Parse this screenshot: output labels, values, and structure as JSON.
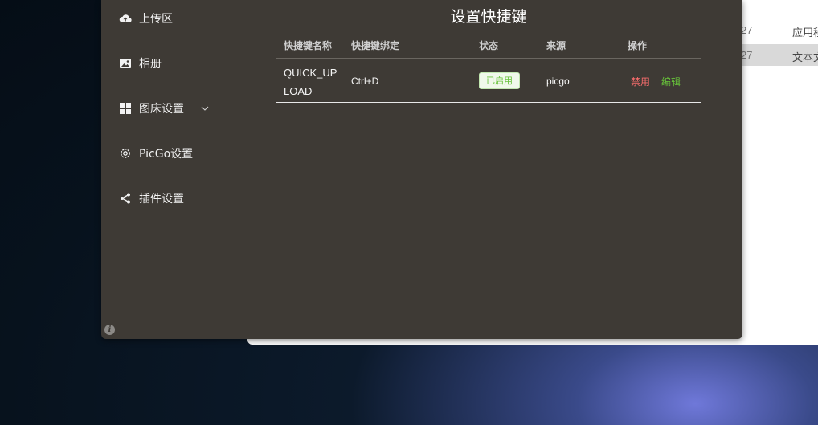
{
  "background_window": {
    "rows": [
      {
        "date_fragment": "27",
        "type_fragment": "应用程"
      },
      {
        "date_fragment": "27",
        "type_fragment": "文本文"
      }
    ]
  },
  "sidebar": {
    "items": [
      {
        "label": "上传区",
        "icon": "cloud-upload-icon"
      },
      {
        "label": "相册",
        "icon": "image-icon"
      },
      {
        "label": "图床设置",
        "icon": "grid-icon",
        "has_chevron": true
      },
      {
        "label": "PicGo设置",
        "icon": "gear-icon"
      },
      {
        "label": "插件设置",
        "icon": "share-icon"
      }
    ],
    "info_icon": "i"
  },
  "page": {
    "title": "设置快捷键"
  },
  "table": {
    "headers": [
      "快捷键名称",
      "快捷键绑定",
      "状态",
      "来源",
      "操作"
    ],
    "rows": [
      {
        "name_line1": "QUICK_UP",
        "name_line2": "LOAD",
        "binding": "Ctrl+D",
        "status": "已启用",
        "source": "picgo",
        "action_disable": "禁用",
        "action_edit": "编辑"
      }
    ]
  },
  "colors": {
    "app_bg": "#3e3a35",
    "enabled_green": "#67c23a",
    "disable_red": "#f56c6c"
  }
}
